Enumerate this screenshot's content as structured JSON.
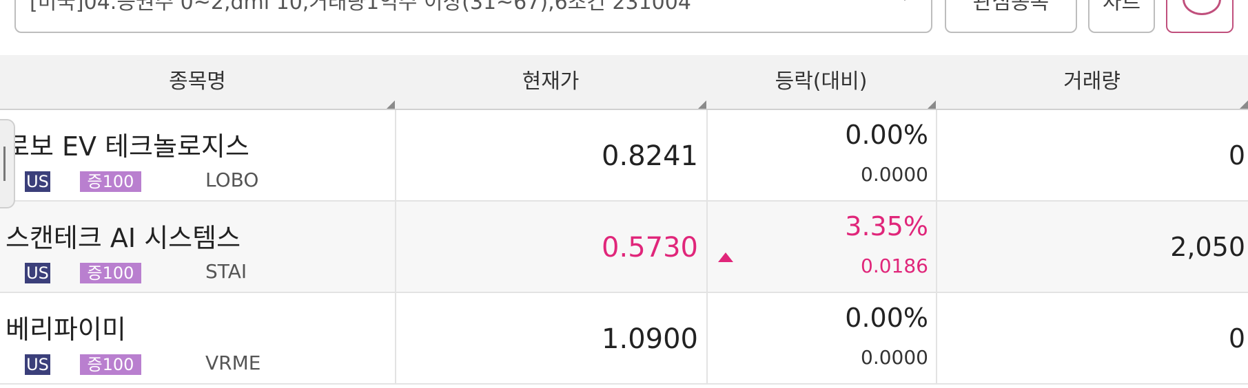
{
  "toolbar": {
    "condition_text": "[미국]04.증권주 0~2,dmi 10,거래량1억주 이상(31~67),6조건 231004",
    "interest_label": "관심종목",
    "chart_label": "차트",
    "refresh_icon": "refresh-icon"
  },
  "table": {
    "headers": [
      "종목명",
      "현재가",
      "등락(대비)",
      "거래량"
    ],
    "rows": [
      {
        "name": "로보 EV 테크놀로지스",
        "market": "US",
        "margin": "증100",
        "ticker": "LOBO",
        "price": "0.8241",
        "change_rate": "0.00%",
        "change_amount": "0.0000",
        "volume": "0",
        "direction": "flat"
      },
      {
        "name": "스캔테크 AI 시스템스",
        "market": "US",
        "margin": "증100",
        "ticker": "STAI",
        "price": "0.5730",
        "change_rate": "3.35%",
        "change_amount": "0.0186",
        "volume": "2,050",
        "direction": "up"
      },
      {
        "name": "베리파이미",
        "market": "US",
        "margin": "증100",
        "ticker": "VRME",
        "price": "1.0900",
        "change_rate": "0.00%",
        "change_amount": "0.0000",
        "volume": "0",
        "direction": "flat"
      }
    ]
  },
  "colors": {
    "up": "#e0267a",
    "us_badge": "#3b3f7a",
    "margin_badge": "#b97fcf",
    "header_bg": "#f2f2f2"
  }
}
